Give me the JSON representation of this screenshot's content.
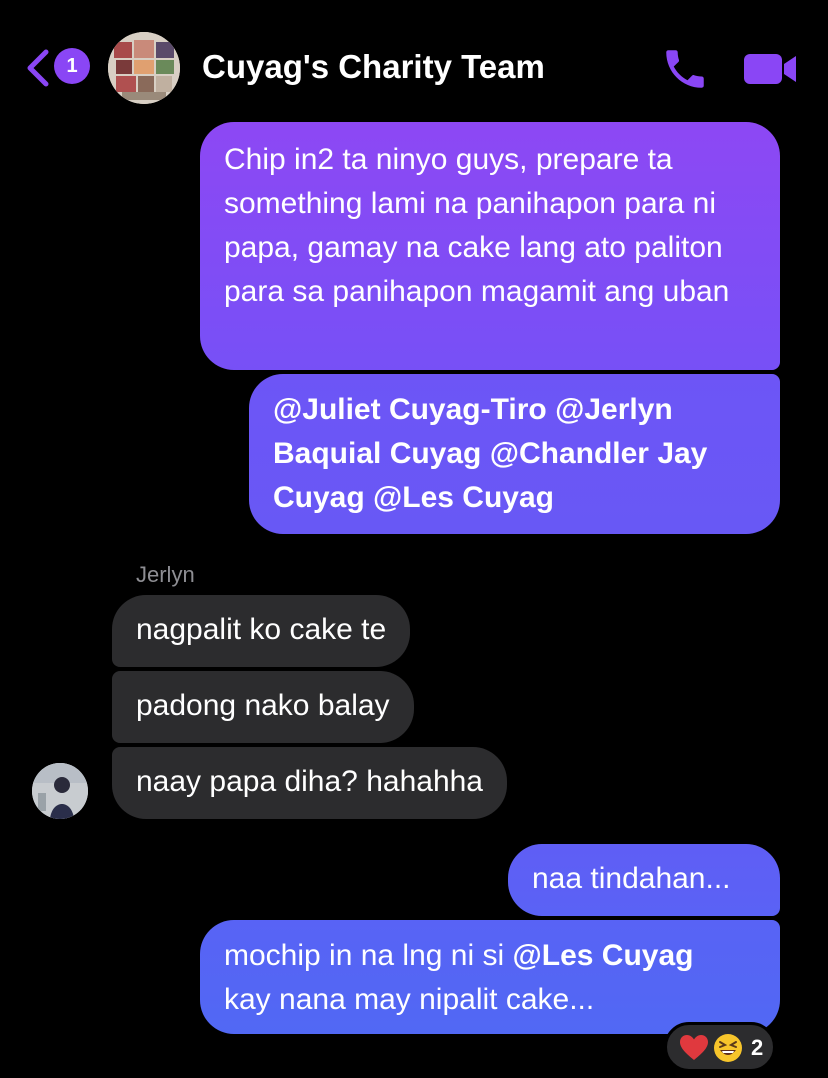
{
  "header": {
    "unread_count": "1",
    "title": "Cuyag's Charity Team",
    "back_icon": "chevron-left-icon",
    "call_icon": "phone-icon",
    "video_icon": "video-camera-icon",
    "accent_color": "#8a46f5"
  },
  "messages": {
    "m1": "Chip in2 ta ninyo guys, prepare ta something lami na panihapon para ni papa, gamay na cake lang ato paliton para sa panihapon magamit ang uban",
    "m2": "@Juliet Cuyag-Tiro @Jerlyn Baquial Cuyag @Chandler Jay Cuyag @Les Cuyag",
    "sender": "Jerlyn",
    "m3": "nagpalit ko cake te",
    "m4": "padong nako balay",
    "m5": "naay papa diha? hahahha",
    "m6": "naa tindahan...",
    "m7_prefix": "mochip in na lng ni si ",
    "m7_mention": "@Les Cuyag",
    "m7_suffix": "kay nana may nipalit cake..."
  },
  "reactions": {
    "icons": [
      "heart-icon",
      "grinning-squinting-face-icon"
    ],
    "count": "2"
  }
}
